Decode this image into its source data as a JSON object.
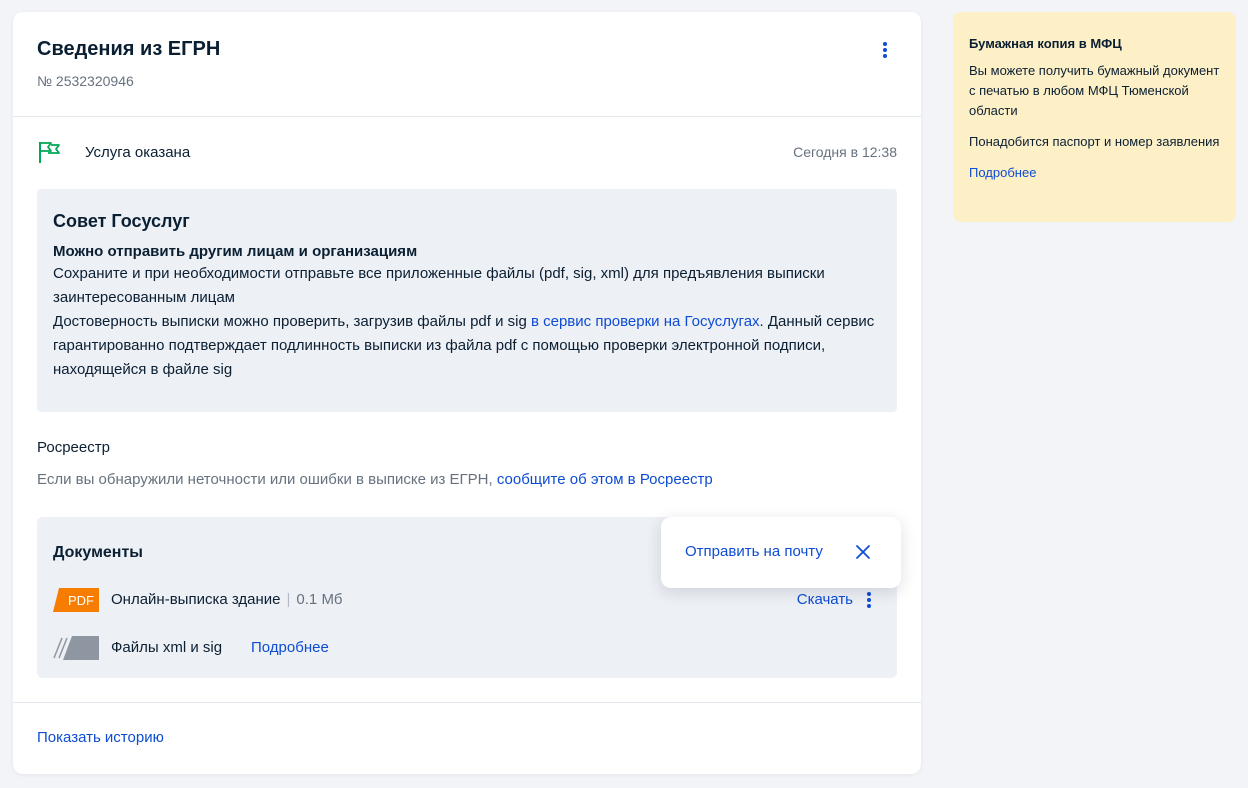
{
  "request": {
    "title": "Сведения из ЕГРН",
    "number": "№ 2532320946"
  },
  "status": {
    "label": "Услуга оказана",
    "time": "Сегодня в 12:38",
    "icon": "flag-icon",
    "icon_color": "#00a855"
  },
  "tip": {
    "title": "Совет Госуслуг",
    "subtitle": "Можно отправить другим лицам и организациям",
    "text1": "Сохраните и при необходимости отправьте все приложенные файлы (pdf, sig, xml) для предъявления выписки заинтересованным лицам",
    "text2_before": "Достоверность выписки можно проверить, загрузив файлы pdf и sig ",
    "text2_link": "в сервис проверки на Госуслугах",
    "text2_after": ". Данный сервис гарантированно подтверждает подлинность выписки из файла pdf с помощью проверки электронной подписи, находящейся в файле sig"
  },
  "rosreestr": {
    "title": "Росреестр",
    "text": "Если вы обнаружили неточности или ошибки в выписке из ЕГРН, ",
    "link": "сообщите об этом в Росреестр"
  },
  "documents": {
    "title": "Документы",
    "pdf_badge": "PDF",
    "pdf_color": "#f77d00",
    "file_name": "Онлайн-выписка здание",
    "file_sep": "|",
    "file_size": "0.1 Мб",
    "download": "Скачать",
    "xml_name": "Файлы xml и sig",
    "xml_more": "Подробнее"
  },
  "popup": {
    "send_to_email": "Отправить на почту"
  },
  "footer": {
    "show_history": "Показать историю"
  },
  "side": {
    "title": "Бумажная копия в МФЦ",
    "text1": "Вы можете получить бумажный документ с печатью в любом МФЦ Тюменской области",
    "text2": "Понадобится паспорт и номер заявления",
    "more": "Подробнее"
  }
}
